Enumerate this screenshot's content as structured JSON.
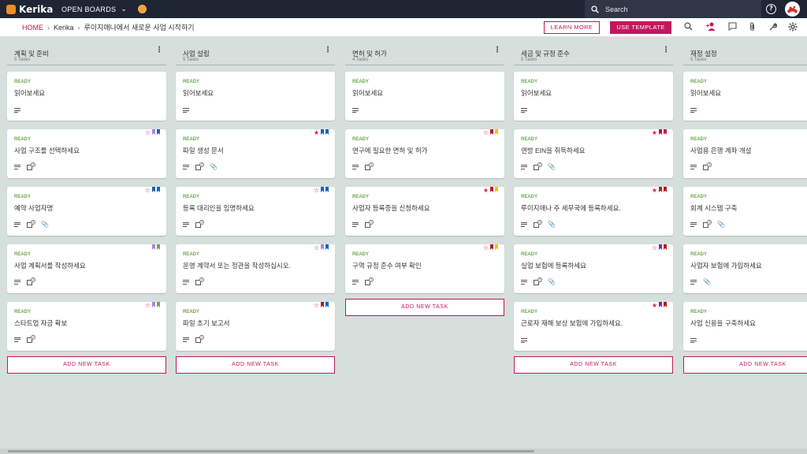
{
  "brand": {
    "name": "Kerika"
  },
  "nav": {
    "open_boards": "OPEN BOARDS"
  },
  "search": {
    "placeholder": "Search"
  },
  "breadcrumb": {
    "home": "HOME",
    "org": "Kerika",
    "board": "루이지애나에서 새로운 사업 시작하기"
  },
  "actions": {
    "learn_more": "LEARN MORE",
    "use_template": "USE TEMPLATE"
  },
  "add_task_label": "ADD NEW TASK",
  "colors": {
    "accent": "#c2185b",
    "ready": "#6aa84f",
    "topbar": "#1f2533",
    "board_bg": "#d5dfdc"
  },
  "columns": [
    {
      "title": "계획 및 준비",
      "count": "5 Tasks",
      "cards": [
        {
          "status": "READY",
          "title": "읽어보세요",
          "attach": false,
          "check": null,
          "star": null,
          "flags": []
        },
        {
          "status": "READY",
          "title": "사업 구조를 선택하세요",
          "attach": false,
          "check": "2",
          "star": "outline",
          "flags": [
            "#b57edc",
            "#1565c0"
          ]
        },
        {
          "status": "READY",
          "title": "예약 사업자명",
          "attach": true,
          "check": "2",
          "star": "outline",
          "flags": [
            "#1565c0",
            "#1565c0"
          ]
        },
        {
          "status": "READY",
          "title": "사업 계획서를 작성하세요",
          "attach": false,
          "check": "2",
          "star": null,
          "flags": [
            "#b57edc",
            "#6aa84f"
          ]
        },
        {
          "status": "READY",
          "title": "스타트업 자금 확보",
          "attach": false,
          "check": "2",
          "star": "outline",
          "flags": [
            "#b57edc",
            "#6aa84f"
          ]
        }
      ]
    },
    {
      "title": "사업 설립",
      "count": "5 Tasks",
      "cards": [
        {
          "status": "READY",
          "title": "읽어보세요",
          "attach": false,
          "check": null,
          "star": null,
          "flags": []
        },
        {
          "status": "READY",
          "title": "파일 생성 문서",
          "attach": true,
          "check": "2",
          "star": "filled",
          "flags": [
            "#1565c0",
            "#1565c0"
          ]
        },
        {
          "status": "READY",
          "title": "등록 대리인을 임명하세요",
          "attach": false,
          "check": "1",
          "star": "outline",
          "flags": [
            "#1565c0",
            "#1565c0"
          ]
        },
        {
          "status": "READY",
          "title": "운영 계약서 또는 정관을 작성하십시오.",
          "attach": false,
          "check": "1",
          "star": "outline",
          "flags": [
            "#b57edc",
            "#1565c0"
          ]
        },
        {
          "status": "READY",
          "title": "파일 초기 보고서",
          "attach": false,
          "check": "1",
          "star": "outline",
          "flags": [
            "#b71c1c",
            "#1565c0"
          ]
        }
      ]
    },
    {
      "title": "면허 및 허가",
      "count": "4 Tasks",
      "cards": [
        {
          "status": "READY",
          "title": "읽어보세요",
          "attach": false,
          "check": null,
          "star": null,
          "flags": []
        },
        {
          "status": "READY",
          "title": "연구에 필요한 면허 및 허가",
          "attach": false,
          "check": "1",
          "star": "outline",
          "flags": [
            "#b71c1c",
            "#f4c20d"
          ]
        },
        {
          "status": "READY",
          "title": "사업자 등록증을 신청하세요",
          "attach": false,
          "check": "1",
          "star": "filled",
          "flags": [
            "#b71c1c",
            "#f4c20d"
          ]
        },
        {
          "status": "READY",
          "title": "구역 규정 준수 여부 확인",
          "attach": false,
          "check": "1",
          "star": "outline",
          "flags": [
            "#b71c1c",
            "#f4c20d"
          ]
        }
      ]
    },
    {
      "title": "세금 및 규정 준수",
      "count": "5 Tasks",
      "cards": [
        {
          "status": "READY",
          "title": "읽어보세요",
          "attach": false,
          "check": null,
          "star": null,
          "flags": []
        },
        {
          "status": "READY",
          "title": "연방 EIN을 취득하세요",
          "attach": true,
          "check": "1",
          "star": "filled",
          "flags": [
            "#b71c1c",
            "#c2185b"
          ]
        },
        {
          "status": "READY",
          "title": "루이지애나 주 세무국에 등록하세요.",
          "attach": true,
          "check": "1",
          "star": "filled",
          "flags": [
            "#b71c1c",
            "#b71c1c"
          ]
        },
        {
          "status": "READY",
          "title": "실업 보험에 등록하세요",
          "attach": true,
          "check": "1",
          "star": "outline",
          "flags": [
            "#8e24aa",
            "#b71c1c"
          ]
        },
        {
          "status": "READY",
          "title": "근로자 재해 보상 보험에 가입하세요.",
          "attach": false,
          "check": null,
          "star": "filled",
          "flags": [
            "#8e24aa",
            "#b71c1c"
          ]
        }
      ]
    },
    {
      "title": "재정 설정",
      "count": "5 Tasks",
      "cards": [
        {
          "status": "READY",
          "title": "읽어보세요",
          "attach": false,
          "check": null,
          "star": null,
          "flags": []
        },
        {
          "status": "READY",
          "title": "사업용 은행 계좌 개설",
          "attach": false,
          "check": "1",
          "star": null,
          "flags": []
        },
        {
          "status": "READY",
          "title": "회계 시스템 구축",
          "attach": true,
          "check": "1",
          "star": null,
          "flags": []
        },
        {
          "status": "READY",
          "title": "사업자 보험에 가입하세요",
          "attach": true,
          "check": null,
          "star": null,
          "flags": []
        },
        {
          "status": "READY",
          "title": "사업 신용을 구축하세요",
          "attach": false,
          "check": null,
          "star": null,
          "flags": []
        }
      ]
    }
  ]
}
